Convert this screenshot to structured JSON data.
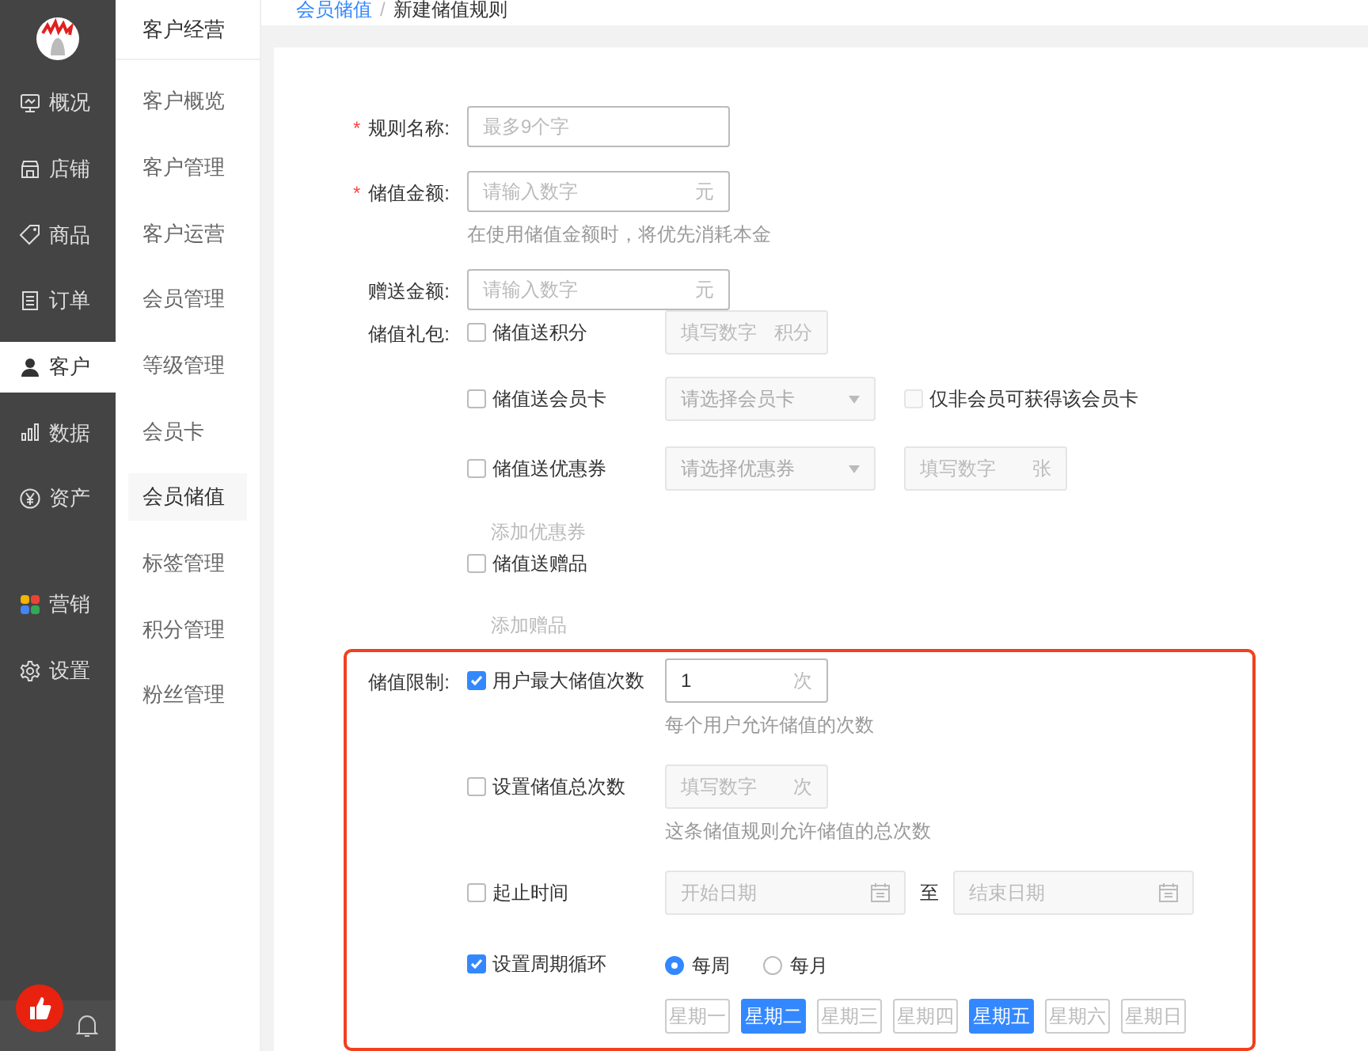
{
  "sidebar": {
    "items": [
      {
        "label": "概况",
        "selected": false
      },
      {
        "label": "店铺",
        "selected": false
      },
      {
        "label": "商品",
        "selected": false
      },
      {
        "label": "订单",
        "selected": false
      },
      {
        "label": "客户",
        "selected": true
      },
      {
        "label": "数据",
        "selected": false
      },
      {
        "label": "资产",
        "selected": false
      },
      {
        "label": "营销",
        "selected": false
      },
      {
        "label": "设置",
        "selected": false
      }
    ]
  },
  "subnav": {
    "title": "客户经营",
    "items": [
      {
        "label": "客户概览",
        "selected": false
      },
      {
        "label": "客户管理",
        "selected": false
      },
      {
        "label": "客户运营",
        "selected": false
      },
      {
        "label": "会员管理",
        "selected": false
      },
      {
        "label": "等级管理",
        "selected": false
      },
      {
        "label": "会员卡",
        "selected": false
      },
      {
        "label": "会员储值",
        "selected": true
      },
      {
        "label": "标签管理",
        "selected": false
      },
      {
        "label": "积分管理",
        "selected": false
      },
      {
        "label": "粉丝管理",
        "selected": false
      }
    ]
  },
  "breadcrumb": [
    {
      "label": "会员储值",
      "kind": "link"
    },
    {
      "label": "新建储值规则",
      "kind": "current",
      "separator": "/"
    }
  ],
  "form": {
    "fields": [
      {
        "kind": "input",
        "label": "规则名称:",
        "required_mark": "*",
        "placeholder": "最多9个字"
      },
      {
        "kind": "input",
        "label": "储值金额:",
        "required_mark": "*",
        "placeholder": "请输入数字",
        "suffix": "元",
        "hint": "在使用储值金额时，将优先消耗本金"
      },
      {
        "kind": "input",
        "label": "赠送金额:",
        "placeholder": "请输入数字",
        "suffix": "元"
      },
      {
        "kind": "options",
        "label": "储值礼包:",
        "highlighted": false,
        "options": [
          {
            "kind": "number",
            "label": "储值送积分",
            "checked": false,
            "placeholder": "填写数字",
            "suffix": "积分"
          },
          {
            "kind": "card",
            "label": "储值送会员卡",
            "checked": false,
            "select": "请选择会员卡",
            "extra": {
              "label": "仅非会员可获得该会员卡",
              "checked": false
            }
          },
          {
            "kind": "coupon",
            "label": "储值送优惠券",
            "checked": false,
            "select": "请选择优惠券",
            "placeholder": "填写数字",
            "suffix": "张",
            "link": "添加优惠券"
          },
          {
            "kind": "gift",
            "label": "储值送赠品",
            "checked": false,
            "link": "添加赠品"
          }
        ]
      },
      {
        "kind": "options",
        "label": "储值限制:",
        "highlighted": true,
        "options": [
          {
            "kind": "number",
            "label": "用户最大储值次数",
            "checked": true,
            "value": "1",
            "suffix": "次",
            "hint": "每个用户允许储值的次数"
          },
          {
            "kind": "number",
            "label": "设置储值总次数",
            "checked": false,
            "placeholder": "填写数字",
            "suffix": "次",
            "hint": "这条储值规则允许储值的总次数"
          },
          {
            "kind": "dates",
            "label": "起止时间",
            "checked": false,
            "start": "开始日期",
            "separator": "至",
            "end": "结束日期"
          },
          {
            "kind": "cycle",
            "label": "设置周期循环",
            "checked": true,
            "radios": [
              {
                "label": "每周",
                "selected": true
              },
              {
                "label": "每月",
                "selected": false
              }
            ],
            "days": [
              {
                "label": "星期一",
                "selected": false
              },
              {
                "label": "星期二",
                "selected": true
              },
              {
                "label": "星期三",
                "selected": false
              },
              {
                "label": "星期四",
                "selected": false
              },
              {
                "label": "星期五",
                "selected": true
              },
              {
                "label": "星期六",
                "selected": false
              },
              {
                "label": "星期日",
                "selected": false
              }
            ]
          }
        ]
      }
    ]
  }
}
